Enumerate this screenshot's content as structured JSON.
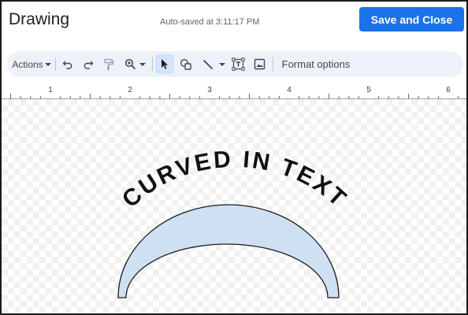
{
  "header": {
    "title": "Drawing",
    "autosave": "Auto-saved at 3:11:17 PM",
    "save_close_label": "Save and Close"
  },
  "toolbar": {
    "actions_label": "Actions",
    "format_options_label": "Format options",
    "tools": [
      "undo-icon",
      "redo-icon",
      "paint-format-icon",
      "zoom-icon",
      "select-icon",
      "shape-icon",
      "line-icon",
      "text-box-icon",
      "image-icon"
    ],
    "active_tool": "select-icon"
  },
  "ruler": {
    "labels": [
      "1",
      "2",
      "3",
      "4",
      "5",
      "6"
    ]
  },
  "drawing": {
    "word_art_text": "CURVED IN TEXT",
    "arch_fill": "#cfe0f3",
    "arch_stroke": "#1a1a1a",
    "text_color": "#111111"
  },
  "colors": {
    "accent": "#1a73e8",
    "toolbar_bg": "#edf2fa",
    "active_tool_bg": "#d3e3fd"
  }
}
